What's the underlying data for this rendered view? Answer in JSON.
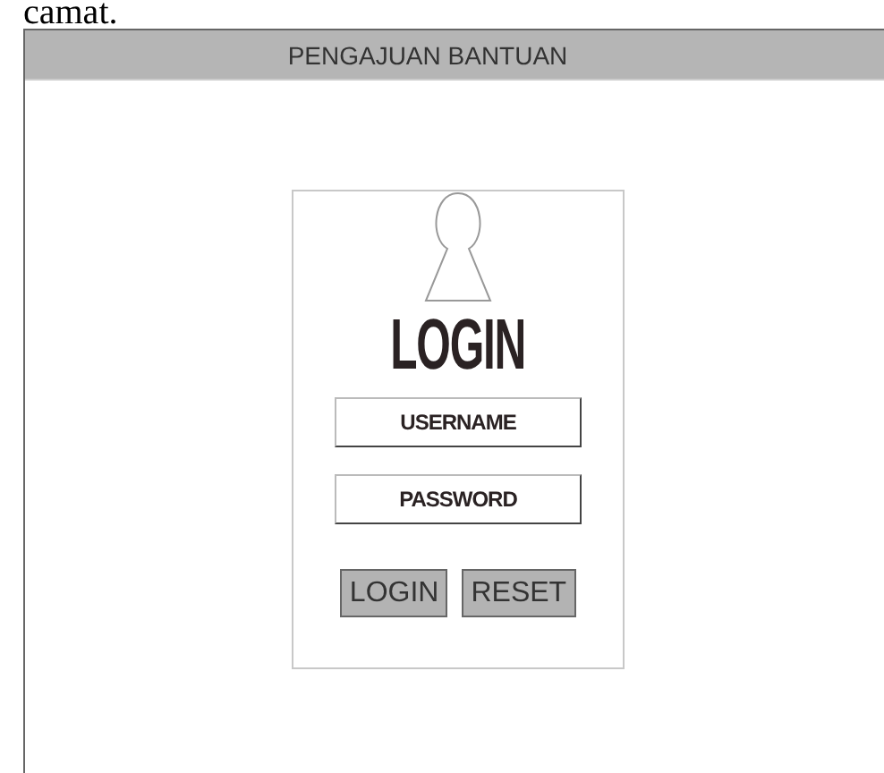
{
  "caption": "camat.",
  "window": {
    "title": "PENGAJUAN BANTUAN"
  },
  "login": {
    "heading": "LOGIN",
    "fields": [
      {
        "placeholder": "USERNAME"
      },
      {
        "placeholder": "PASSWORD"
      }
    ],
    "buttons": [
      "LOGIN",
      "RESET"
    ]
  }
}
